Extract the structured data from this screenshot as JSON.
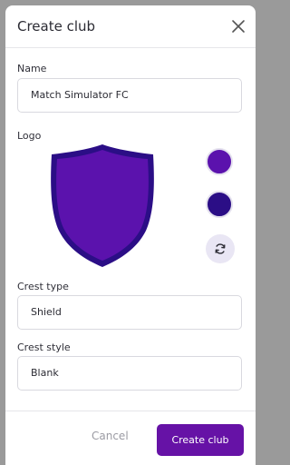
{
  "dialog": {
    "title": "Create club"
  },
  "name": {
    "label": "Name",
    "value": "Match Simulator FC"
  },
  "logo": {
    "label": "Logo",
    "primary_color": "#5b12ad",
    "secondary_color": "#2b0e86",
    "swatches": [
      "#5b12ad",
      "#2b0e86"
    ]
  },
  "crest_type": {
    "label": "Crest type",
    "value": "Shield"
  },
  "crest_style": {
    "label": "Crest style",
    "value": "Blank"
  },
  "footer": {
    "cancel_label": "Cancel",
    "create_label": "Create club"
  }
}
